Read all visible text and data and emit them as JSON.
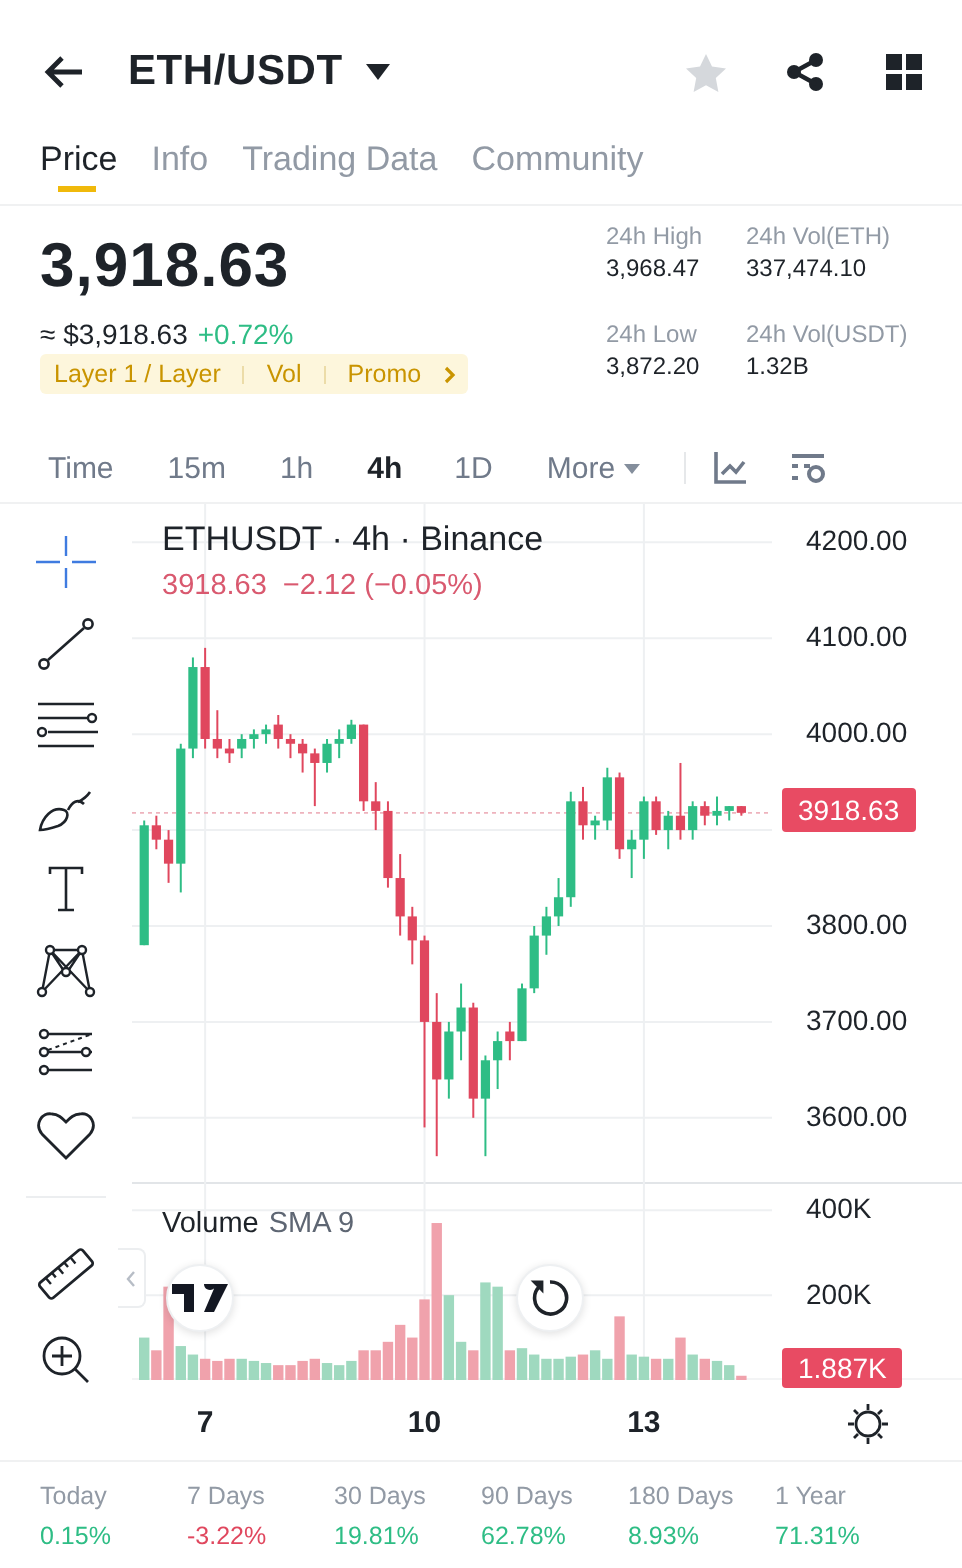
{
  "header": {
    "title": "ETH/USDT",
    "favorite": false
  },
  "tabs": [
    {
      "label": "Price",
      "selected": true
    },
    {
      "label": "Info",
      "selected": false
    },
    {
      "label": "Trading Data",
      "selected": false
    },
    {
      "label": "Community",
      "selected": false
    }
  ],
  "price": {
    "last": "3,918.63",
    "approx": "≈ $3,918.63",
    "change": "+0.72%",
    "tags": [
      "Layer 1 / Layer",
      "Vol",
      "Promo"
    ]
  },
  "stats": [
    {
      "label": "24h High",
      "value": "3,968.47"
    },
    {
      "label": "24h Vol(ETH)",
      "value": "337,474.10"
    },
    {
      "label": "24h Low",
      "value": "3,872.20"
    },
    {
      "label": "24h Vol(USDT)",
      "value": "1.32B"
    }
  ],
  "intervals": [
    {
      "label": "Time",
      "selected": false
    },
    {
      "label": "15m",
      "selected": false
    },
    {
      "label": "1h",
      "selected": false
    },
    {
      "label": "4h",
      "selected": true
    },
    {
      "label": "1D",
      "selected": false
    },
    {
      "label": "More",
      "selected": false
    }
  ],
  "price_chart": {
    "legend": "ETHUSDT · 4h · Binance",
    "ohlc_price": "3918.63",
    "ohlc_change": "−2.12 (−0.05%)",
    "last_price_label": "3918.63",
    "chart_data": {
      "type": "candlestick",
      "grid": true,
      "xlim": [
        6,
        17.35
      ],
      "ylim": [
        3531,
        4240
      ],
      "x": [
        6.167,
        6.333,
        6.5,
        6.667,
        6.833,
        7,
        7.167,
        7.333,
        7.5,
        7.667,
        7.833,
        8,
        8.167,
        8.333,
        8.5,
        8.667,
        8.833,
        9,
        9.167,
        9.333,
        9.5,
        9.667,
        9.833,
        10,
        10.167,
        10.333,
        10.5,
        10.667,
        10.833,
        11,
        11.167,
        11.333,
        11.5,
        11.667,
        11.833,
        12,
        12.167,
        12.333,
        12.5,
        12.667,
        12.833,
        13,
        13.167,
        13.333,
        13.5,
        13.667,
        13.833,
        14,
        14.167,
        14.333
      ],
      "ohlc": [
        [
          3780,
          3910,
          3780,
          3905
        ],
        [
          3905,
          3915,
          3880,
          3890
        ],
        [
          3890,
          3900,
          3845,
          3865
        ],
        [
          3865,
          3990,
          3835,
          3985
        ],
        [
          3985,
          4080,
          3975,
          4070
        ],
        [
          4070,
          4090,
          3985,
          3995
        ],
        [
          3995,
          4025,
          3975,
          3985
        ],
        [
          3985,
          3995,
          3970,
          3980
        ],
        [
          3985,
          4000,
          3975,
          3995
        ],
        [
          3995,
          4005,
          3985,
          4000
        ],
        [
          4000,
          4010,
          3990,
          4005
        ],
        [
          4010,
          4020,
          3985,
          3995
        ],
        [
          3995,
          4000,
          3975,
          3990
        ],
        [
          3990,
          3995,
          3960,
          3980
        ],
        [
          3980,
          3985,
          3925,
          3970
        ],
        [
          3970,
          3995,
          3960,
          3990
        ],
        [
          3990,
          4005,
          3975,
          3995
        ],
        [
          3995,
          4015,
          3990,
          4010
        ],
        [
          4010,
          4010,
          3920,
          3930
        ],
        [
          3930,
          3950,
          3900,
          3920
        ],
        [
          3920,
          3930,
          3840,
          3850
        ],
        [
          3850,
          3875,
          3790,
          3810
        ],
        [
          3810,
          3820,
          3760,
          3785
        ],
        [
          3785,
          3790,
          3590,
          3700
        ],
        [
          3700,
          3730,
          3560,
          3640
        ],
        [
          3640,
          3700,
          3620,
          3690
        ],
        [
          3690,
          3740,
          3660,
          3715
        ],
        [
          3715,
          3720,
          3600,
          3620
        ],
        [
          3620,
          3665,
          3560,
          3660
        ],
        [
          3660,
          3690,
          3630,
          3680
        ],
        [
          3690,
          3700,
          3660,
          3680
        ],
        [
          3680,
          3740,
          3680,
          3735
        ],
        [
          3735,
          3800,
          3730,
          3790
        ],
        [
          3790,
          3820,
          3770,
          3810
        ],
        [
          3810,
          3850,
          3800,
          3830
        ],
        [
          3830,
          3940,
          3820,
          3930
        ],
        [
          3930,
          3945,
          3890,
          3905
        ],
        [
          3905,
          3915,
          3890,
          3910
        ],
        [
          3910,
          3965,
          3900,
          3955
        ],
        [
          3955,
          3960,
          3870,
          3880
        ],
        [
          3880,
          3900,
          3850,
          3890
        ],
        [
          3890,
          3935,
          3870,
          3930
        ],
        [
          3930,
          3935,
          3895,
          3900
        ],
        [
          3900,
          3920,
          3880,
          3915
        ],
        [
          3915,
          3970,
          3890,
          3900
        ],
        [
          3900,
          3930,
          3890,
          3925
        ],
        [
          3925,
          3930,
          3905,
          3915
        ],
        [
          3915,
          3935,
          3905,
          3920
        ],
        [
          3920,
          3925,
          3910,
          3925
        ],
        [
          3925,
          3925,
          3915,
          3918
        ]
      ],
      "yticks": [
        {
          "value": 4200,
          "label": "4200.00"
        },
        {
          "value": 4100,
          "label": "4100.00"
        },
        {
          "value": 4000,
          "label": "4000.00"
        },
        {
          "value": 3800,
          "label": "3800.00"
        },
        {
          "value": 3700,
          "label": "3700.00"
        },
        {
          "value": 3600,
          "label": "3600.00"
        }
      ]
    }
  },
  "volume_chart": {
    "legend": "Volume",
    "sma": "SMA 9",
    "last_volume_label": "1.887K",
    "chart_data": {
      "type": "bar",
      "grid": true,
      "xlim": [
        6,
        17.35
      ],
      "ylim": [
        0,
        462
      ],
      "x": [
        6.167,
        6.333,
        6.5,
        6.667,
        6.833,
        7,
        7.167,
        7.333,
        7.5,
        7.667,
        7.833,
        8,
        8.167,
        8.333,
        8.5,
        8.667,
        8.833,
        9,
        9.167,
        9.333,
        9.5,
        9.667,
        9.833,
        10,
        10.167,
        10.333,
        10.5,
        10.667,
        10.833,
        11,
        11.167,
        11.333,
        11.5,
        11.667,
        11.833,
        12,
        12.167,
        12.333,
        12.5,
        12.667,
        12.833,
        13,
        13.167,
        13.333,
        13.5,
        13.667,
        13.833,
        14,
        14.167,
        14.333
      ],
      "values": [
        100,
        70,
        220,
        80,
        60,
        50,
        45,
        50,
        50,
        45,
        40,
        35,
        35,
        45,
        50,
        40,
        35,
        45,
        70,
        70,
        90,
        130,
        100,
        190,
        370,
        200,
        90,
        70,
        230,
        220,
        70,
        75,
        60,
        50,
        50,
        55,
        60,
        70,
        50,
        150,
        60,
        55,
        50,
        50,
        100,
        60,
        50,
        45,
        35,
        10
      ],
      "yticks": [
        {
          "value": 400,
          "label": "400K"
        },
        {
          "value": 200,
          "label": "200K"
        }
      ],
      "xticks": [
        7,
        10,
        13
      ]
    }
  },
  "performance": [
    {
      "period": "Today",
      "change": "0.15%",
      "color": "#2ebd85"
    },
    {
      "period": "7 Days",
      "change": "-3.22%",
      "color": "#e0475e"
    },
    {
      "period": "30 Days",
      "change": "19.81%",
      "color": "#2ebd85"
    },
    {
      "period": "90 Days",
      "change": "62.78%",
      "color": "#2ebd85"
    },
    {
      "period": "180 Days",
      "change": "8.93%",
      "color": "#2ebd85"
    },
    {
      "period": "1 Year",
      "change": "71.31%",
      "color": "#2ebd85"
    }
  ]
}
